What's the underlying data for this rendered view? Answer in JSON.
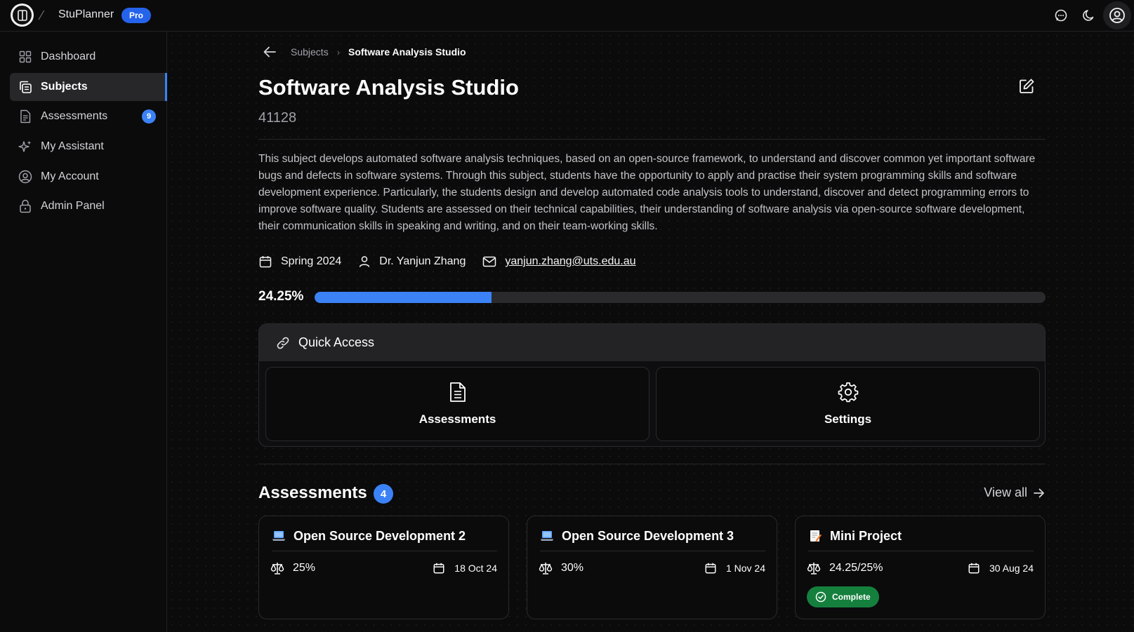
{
  "app": {
    "name": "StuPlanner",
    "badge": "Pro"
  },
  "sidebar": {
    "items": [
      {
        "label": "Dashboard",
        "icon": "grid-icon"
      },
      {
        "label": "Subjects",
        "icon": "copy-icon",
        "active": true
      },
      {
        "label": "Assessments",
        "icon": "document-icon",
        "badge": "9"
      },
      {
        "label": "My Assistant",
        "icon": "sparkles-icon"
      },
      {
        "label": "My Account",
        "icon": "user-circle-icon"
      },
      {
        "label": "Admin Panel",
        "icon": "lock-icon"
      }
    ]
  },
  "breadcrumb": {
    "parent": "Subjects",
    "current": "Software Analysis Studio"
  },
  "subject": {
    "title": "Software Analysis Studio",
    "code": "41128",
    "description": "This subject develops automated software analysis techniques, based on an open-source framework, to understand and discover common yet important software bugs and defects in software systems. Through this subject, students have the opportunity to apply and practise their system programming skills and software development experience. Particularly, the students design and develop automated code analysis tools to understand, discover and detect programming errors to improve software quality. Students are assessed on their technical capabilities, their understanding of software analysis via open-source software development, their communication skills in speaking and writing, and on their team-working skills.",
    "term": "Spring 2024",
    "coordinator": "Dr. Yanjun Zhang",
    "email": "yanjun.zhang@uts.edu.au",
    "progress_label": "24.25%",
    "progress": 0.2425
  },
  "quick_access": {
    "title": "Quick Access",
    "tiles": [
      {
        "label": "Assessments",
        "icon": "document-icon"
      },
      {
        "label": "Settings",
        "icon": "gear-icon"
      }
    ]
  },
  "assessments": {
    "title": "Assessments",
    "count": "4",
    "view_all": "View all",
    "cards": [
      {
        "emoji": "laptop-emoji",
        "title": "Open Source Development 2",
        "weight": "25%",
        "date": "18 Oct 24"
      },
      {
        "emoji": "laptop-emoji",
        "title": "Open Source Development 3",
        "weight": "30%",
        "date": "1 Nov 24"
      },
      {
        "emoji": "memo-emoji",
        "title": "Mini Project",
        "weight": "24.25/25%",
        "date": "30 Aug 24",
        "status": "Complete"
      }
    ]
  },
  "colors": {
    "accent": "#3b82f6",
    "success": "#15803d",
    "background": "#0b0b0c"
  }
}
